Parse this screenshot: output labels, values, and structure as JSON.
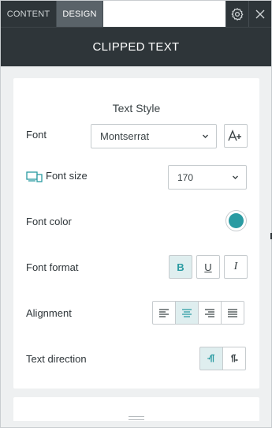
{
  "tabs": [
    {
      "label": "CONTENT",
      "active": false
    },
    {
      "label": "DESIGN",
      "active": true
    }
  ],
  "toolbar": {
    "settings_icon": "gear-icon",
    "close_icon": "close-icon"
  },
  "panel_title": "CLIPPED TEXT",
  "section_title": "Text Style",
  "font": {
    "label": "Font",
    "value": "Montserrat",
    "icon": "font-size-adjust-icon"
  },
  "font_size": {
    "label": "Font size",
    "value": "170",
    "icon": "responsive-devices-icon"
  },
  "font_color": {
    "label": "Font color",
    "value": "#2a9ba2"
  },
  "font_format": {
    "label": "Font format",
    "buttons": [
      {
        "name": "bold",
        "glyph": "B",
        "active": true
      },
      {
        "name": "underline",
        "glyph": "U",
        "active": false
      },
      {
        "name": "italic",
        "glyph": "I",
        "active": false
      }
    ]
  },
  "alignment": {
    "label": "Alignment",
    "buttons": [
      {
        "name": "align-left-icon",
        "active": false
      },
      {
        "name": "align-center-icon",
        "active": true
      },
      {
        "name": "align-right-icon",
        "active": false
      },
      {
        "name": "align-justify-icon",
        "active": false
      }
    ]
  },
  "text_direction": {
    "label": "Text direction",
    "buttons": [
      {
        "name": "ltr-direction-icon",
        "active": true
      },
      {
        "name": "rtl-direction-icon",
        "active": false
      }
    ]
  },
  "colors": {
    "accent": "#2a9ba2",
    "dark": "#2e3539"
  }
}
